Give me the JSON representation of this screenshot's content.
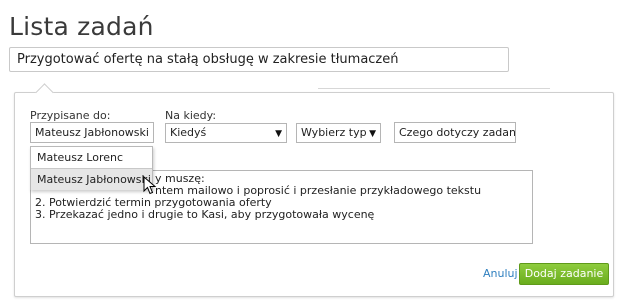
{
  "header": {
    "title": "Lista zadań"
  },
  "task": {
    "title_value": "Przygotować ofertę na stałą obsługę w zakresie tłumaczeń"
  },
  "form": {
    "assigned_label": "Przypisane do:",
    "assigned_value": "Mateusz Jabłonowski",
    "when_label": "Na kiedy:",
    "when_value": "Kiedyś",
    "type_value": "Wybierz typ",
    "concern_value": "Czego dotyczy zadanie?",
    "description_lines": [
      "y muszę:",
      "ntem mailowo i poprosić i przesłanie przykładowego tekstu",
      "2. Potwierdzić termin przygotowania oferty",
      "3. Przekazać jedno i drugie to Kasi, aby przygotowała wycenę"
    ]
  },
  "dropdown": {
    "options": [
      "Mateusz Lorenc",
      "Mateusz Jabłonowski"
    ],
    "highlighted": "Mateusz Jabłonowski"
  },
  "actions": {
    "cancel_label": "Anuluj",
    "submit_label": "Dodaj zadanie"
  },
  "colors": {
    "accent_green": "#7bbd2c",
    "link_blue": "#2f7fbf"
  },
  "icons": {
    "select_arrow": "chevron-down-icon",
    "cursor": "mouse-pointer-icon"
  }
}
